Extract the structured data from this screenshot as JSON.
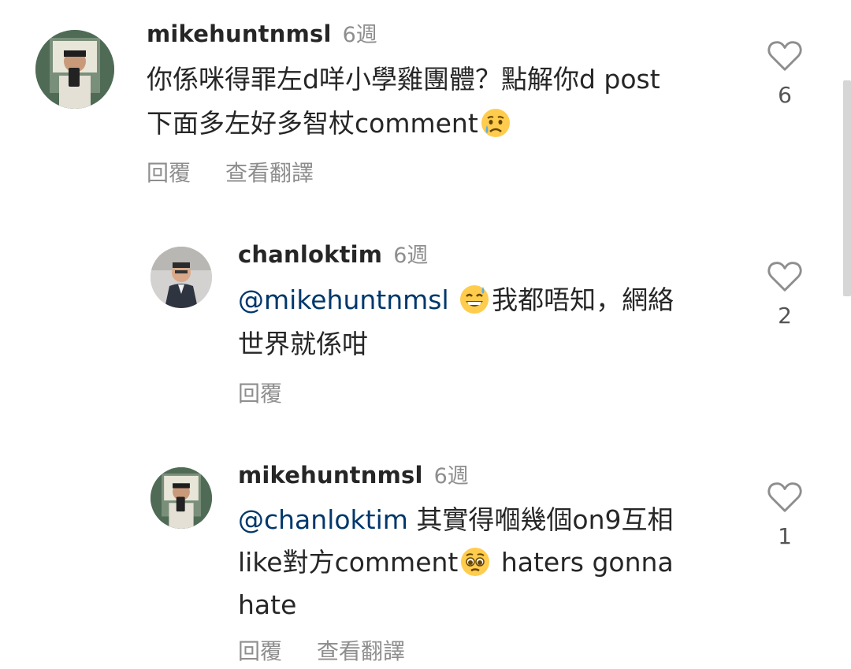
{
  "comments": [
    {
      "username": "mikehuntnmsl",
      "time": "6週",
      "lines": [
        [
          {
            "t": "你係咪得罪左d咩小學雞團體？點解你d post"
          }
        ],
        [
          {
            "t": "下面多左好多智杖comment"
          },
          {
            "emoji": "crying-face"
          }
        ]
      ],
      "actions": [
        "回覆",
        "查看翻譯"
      ],
      "likes": "6"
    },
    {
      "username": "chanloktim",
      "time": "6週",
      "lines": [
        [
          {
            "t": "@mikehuntnmsl",
            "mention": true
          },
          {
            "t": " "
          },
          {
            "emoji": "grinning-sweat-face"
          },
          {
            "t": "我都唔知，網絡"
          }
        ],
        [
          {
            "t": "世界就係咁"
          }
        ]
      ],
      "actions": [
        "回覆"
      ],
      "likes": "2"
    },
    {
      "username": "mikehuntnmsl",
      "time": "6週",
      "lines": [
        [
          {
            "t": "@chanloktim",
            "mention": true
          },
          {
            "t": " 其實得嗰幾個on9互相"
          }
        ],
        [
          {
            "t": "like對方comment"
          },
          {
            "emoji": "pleading-face"
          },
          {
            "t": " haters gonna"
          }
        ],
        [
          {
            "t": "hate"
          }
        ]
      ],
      "actions": [
        "回覆",
        "查看翻譯"
      ],
      "likes": "1"
    }
  ],
  "icons": {
    "like": "heart-outline-icon",
    "emoji_colors": {
      "face": "#FFCC4D",
      "tear": "#5DADEC",
      "mouth": "#664500"
    }
  }
}
